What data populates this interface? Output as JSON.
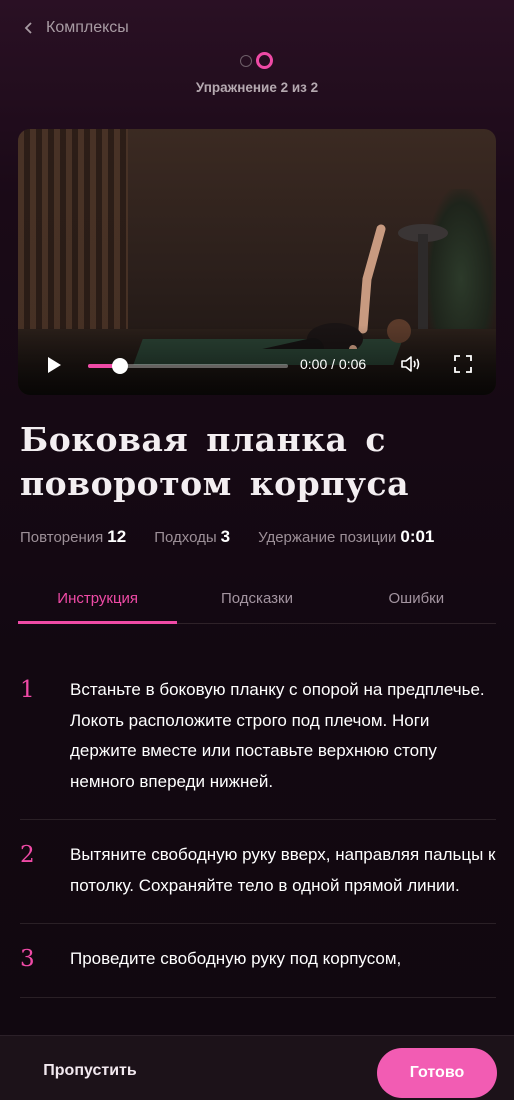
{
  "nav": {
    "back_label": "Комплексы"
  },
  "progress": {
    "text": "Упражнение 2 из 2",
    "current": 2,
    "total": 2
  },
  "video": {
    "time": "0:00 / 0:06",
    "position_fraction": 0.16
  },
  "exercise": {
    "title": "Боковая планка с поворотом корпуса",
    "stats": [
      {
        "label": "Повторения",
        "value": "12"
      },
      {
        "label": "Подходы",
        "value": "3"
      },
      {
        "label": "Удержание позиции",
        "value": "0:01"
      }
    ]
  },
  "tabs": [
    {
      "label": "Инструкция",
      "active": true
    },
    {
      "label": "Подсказки",
      "active": false
    },
    {
      "label": "Ошибки",
      "active": false
    }
  ],
  "steps": [
    {
      "num": "1",
      "text": "Встаньте в боковую планку с опорой на предплечье. Локоть расположите строго под плечом. Ноги держите вместе или поставьте верхнюю стопу немного впереди нижней."
    },
    {
      "num": "2",
      "text": "Вытяните свободную руку вверх, направляя пальцы к потолку. Сохраняйте тело в одной прямой линии."
    },
    {
      "num": "3",
      "text": "Проведите свободную руку под корпусом,"
    }
  ],
  "footer": {
    "skip_label": "Пропустить",
    "done_label": "Готово"
  },
  "colors": {
    "accent": "#ef4aa6",
    "background": "#120811"
  },
  "icons": [
    "back-chevron-icon",
    "play-icon",
    "volume-icon",
    "fullscreen-icon"
  ]
}
